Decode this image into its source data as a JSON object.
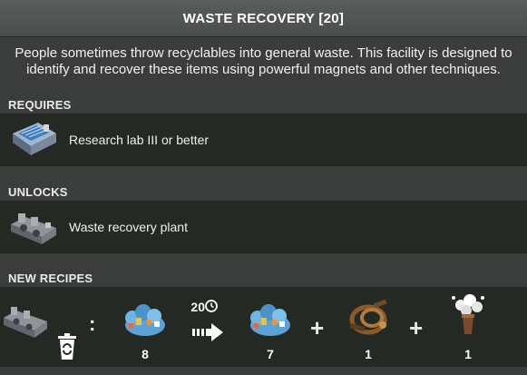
{
  "window": {
    "title": "WASTE RECOVERY [20]"
  },
  "description": "People sometimes throw recyclables into general waste. This facility is designed to identify and recover these items using powerful magnets and other techniques.",
  "requires": {
    "header": "REQUIRES",
    "items": [
      {
        "icon": "research-lab-icon",
        "label": "Research lab III or better"
      }
    ]
  },
  "unlocks": {
    "header": "UNLOCKS",
    "items": [
      {
        "icon": "waste-recovery-plant-icon",
        "label": "Waste recovery plant"
      }
    ]
  },
  "recipes": {
    "header": "NEW RECIPES",
    "colon": ":",
    "duration": "20",
    "input": {
      "icon": "mixed-waste-icon",
      "qty": "8"
    },
    "outputs": [
      {
        "icon": "mixed-waste-icon",
        "qty": "7"
      },
      {
        "icon": "scrap-metal-icon",
        "qty": "1"
      },
      {
        "icon": "exhaust-smoke-icon",
        "qty": "1"
      }
    ],
    "plus": "+"
  },
  "colors": {
    "row_bg": "#252924",
    "panel_bg": "#3a3d3b",
    "title_bg": "#4f5250"
  }
}
